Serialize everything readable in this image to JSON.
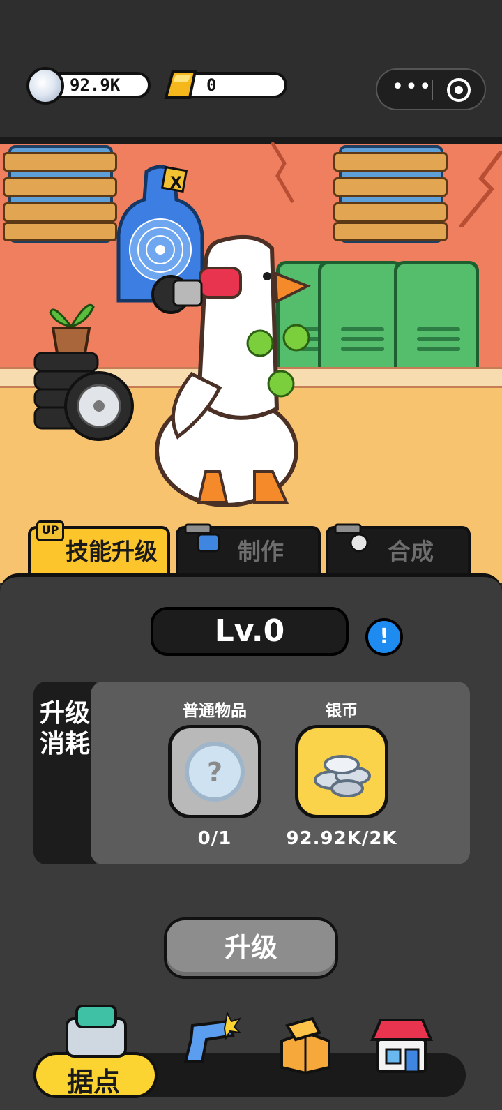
{
  "resources": {
    "silver": {
      "value": "92.9K",
      "icon": "silver-coin-icon"
    },
    "gold": {
      "value": "0",
      "icon": "gold-bar-icon"
    }
  },
  "capsule": {
    "more": "•••",
    "close_icon": "target-icon"
  },
  "tabs": [
    {
      "label": "技能升级",
      "active": true,
      "badge": "UP"
    },
    {
      "label": "制作",
      "active": false
    },
    {
      "label": "合成",
      "active": false
    }
  ],
  "skill": {
    "level": "Lv.0",
    "info": "!",
    "cost_label": "升级消耗",
    "costs": [
      {
        "name": "普通物品",
        "count": "0/1",
        "icon": "question-orb-icon"
      },
      {
        "name": "银币",
        "count": "92.92K/2K",
        "icon": "silver-coins-icon"
      }
    ],
    "upgrade_label": "升级"
  },
  "scene": {
    "target_sign": "X"
  },
  "nav": [
    {
      "label": "据点",
      "icon": "base-icon",
      "active": true
    },
    {
      "label": "",
      "icon": "revolver-icon",
      "active": false
    },
    {
      "label": "",
      "icon": "box-icon",
      "active": false
    },
    {
      "label": "",
      "icon": "shop-icon",
      "active": false
    }
  ],
  "colors": {
    "accent": "#fcc52c",
    "panel": "#3b3b3b",
    "info": "#1e8bf0"
  }
}
